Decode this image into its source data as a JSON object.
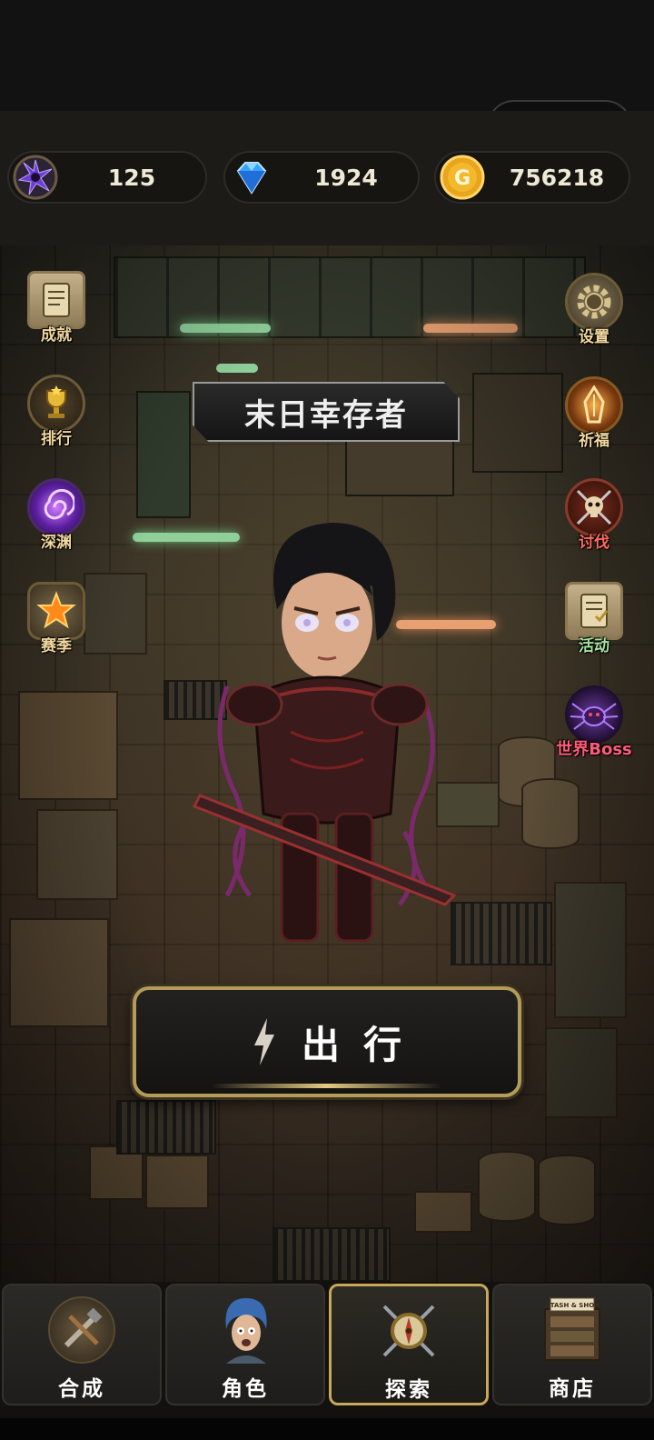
{
  "resources": [
    {
      "id": "void-crystal",
      "icon": "void-crystal-icon",
      "value": "125"
    },
    {
      "id": "diamond",
      "icon": "diamond-icon",
      "value": "1924"
    },
    {
      "id": "gold",
      "icon": "gold-coin-icon",
      "icon_text": "G",
      "value": "756218"
    }
  ],
  "left_menu": [
    {
      "label": "成就",
      "icon": "scroll-icon"
    },
    {
      "label": "排行",
      "icon": "trophy-icon"
    },
    {
      "label": "深渊",
      "icon": "vortex-icon"
    },
    {
      "label": "赛季",
      "icon": "star-icon"
    }
  ],
  "right_menu": [
    {
      "label": "设置",
      "icon": "gear-icon"
    },
    {
      "label": "祈福",
      "icon": "shrine-icon"
    },
    {
      "label": "讨伐",
      "icon": "skull-swords-icon"
    },
    {
      "label": "活动",
      "icon": "scroll-icon"
    },
    {
      "label": "世界Boss",
      "icon": "spider-boss-icon"
    }
  ],
  "character": {
    "title": "末日幸存者"
  },
  "action_button": {
    "label": "出行",
    "icon": "lightning-icon"
  },
  "tabs": [
    {
      "label": "合成",
      "icon": "tools-icon",
      "active": false
    },
    {
      "label": "角色",
      "icon": "survivor-avatar-icon",
      "active": false
    },
    {
      "label": "探索",
      "icon": "compass-swords-icon",
      "active": true
    },
    {
      "label": "商店",
      "icon": "stash-shop-icon",
      "icon_text": "STASH & SHOP",
      "active": false
    }
  ],
  "colors": {
    "accent_gold": "#c9a857",
    "label_gold": "#f1d79d",
    "label_red": "#ff6a5a",
    "label_green": "#a6e5a0",
    "label_boss": "#ff5a7a"
  }
}
